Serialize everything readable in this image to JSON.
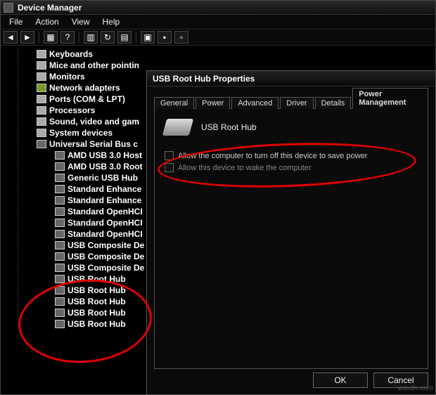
{
  "dm": {
    "title": "Device Manager",
    "menu": {
      "file": "File",
      "action": "Action",
      "view": "View",
      "help": "Help"
    },
    "tree": {
      "keyboards": "Keyboards",
      "mice": "Mice and other pointin",
      "monitors": "Monitors",
      "network": "Network adapters",
      "ports": "Ports (COM & LPT)",
      "processors": "Processors",
      "sound": "Sound, video and gam",
      "sysdev": "System devices",
      "usbctrl": "Universal Serial Bus c",
      "children": {
        "amdhost": "AMD USB 3.0 Host",
        "amdroot": "AMD USB 3.0 Root",
        "generic": "Generic USB Hub",
        "stdenh1": "Standard Enhance",
        "stdenh2": "Standard Enhance",
        "stdohci1": "Standard OpenHCI",
        "stdohci2": "Standard OpenHCI",
        "stdohci3": "Standard OpenHCI",
        "comp1": "USB Composite De",
        "comp2": "USB Composite De",
        "comp3": "USB Composite De",
        "root1": "USB Root Hub",
        "root2": "USB Root Hub",
        "root3": "USB Root Hub",
        "root4": "USB Root Hub",
        "root5": "USB Root Hub"
      }
    }
  },
  "prop": {
    "title": "USB Root Hub Properties",
    "tabs": {
      "general": "General",
      "power": "Power",
      "advanced": "Advanced",
      "driver": "Driver",
      "details": "Details",
      "powermgmt": "Power Management"
    },
    "device_name": "USB Root Hub",
    "opt1": "Allow the computer to turn off this device to save power",
    "opt2": "Allow this device to wake the computer",
    "ok": "OK",
    "cancel": "Cancel"
  },
  "watermark": "wsxdn.com"
}
